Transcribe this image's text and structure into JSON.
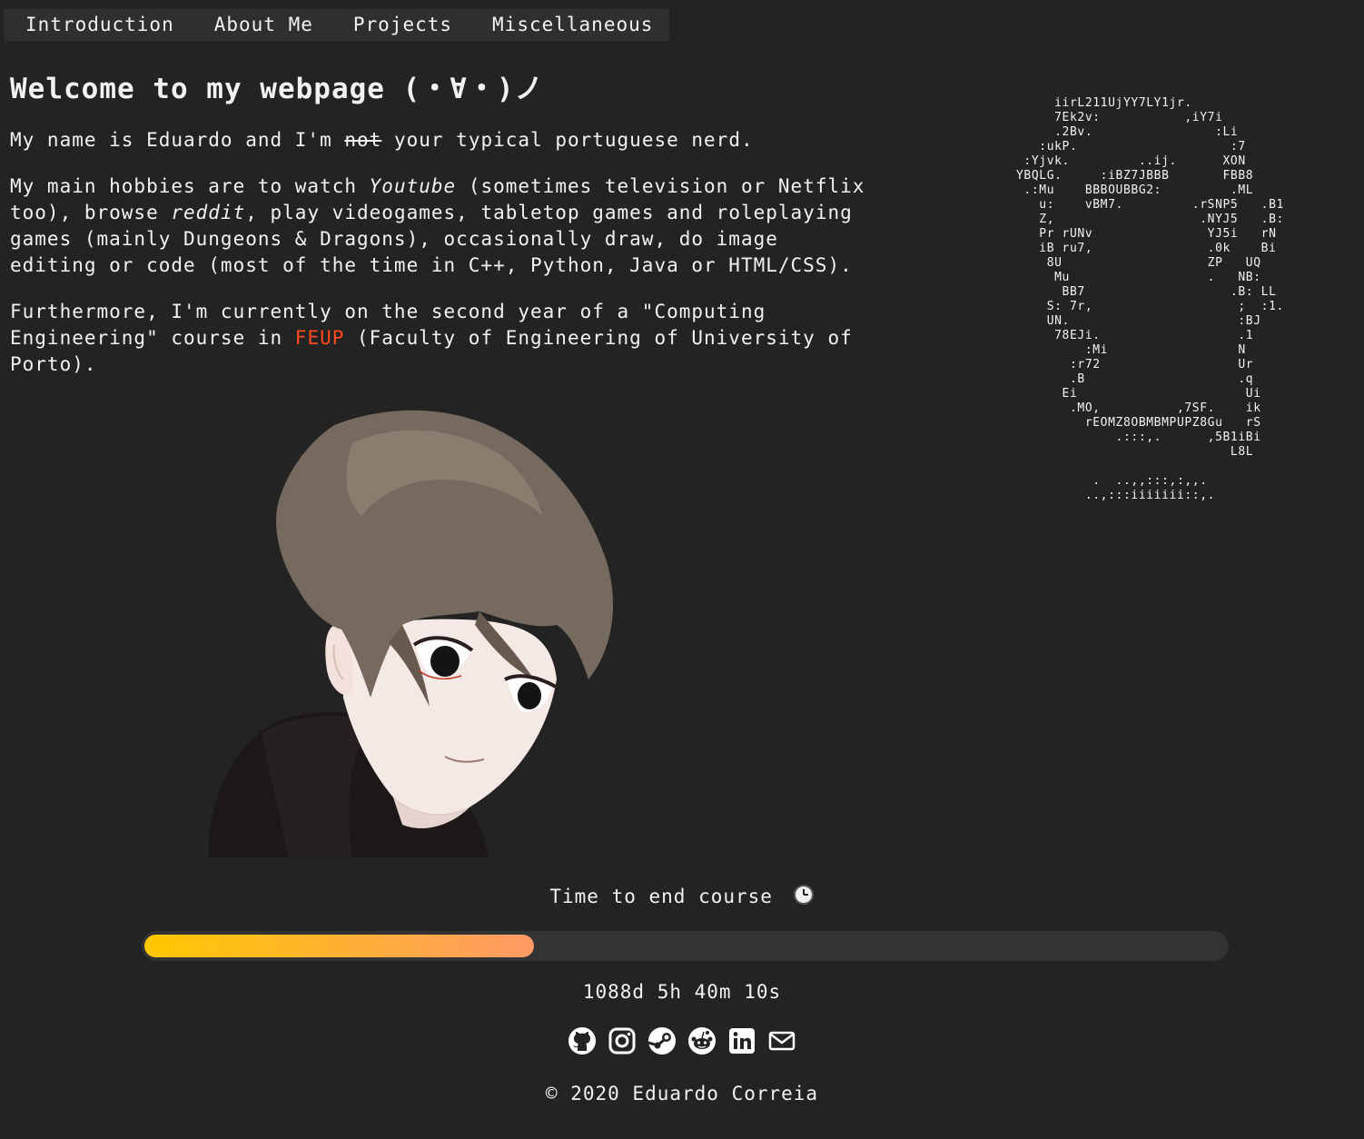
{
  "nav": {
    "items": [
      {
        "label": "Introduction"
      },
      {
        "label": "About Me"
      },
      {
        "label": "Projects"
      },
      {
        "label": "Miscellaneous"
      }
    ]
  },
  "intro": {
    "title": "Welcome to my webpage (・∀・)ノ",
    "p1": {
      "a": "My name is Eduardo and I'm ",
      "strike": "not",
      "b": " your typical portuguese nerd."
    },
    "p2": {
      "a": "My main hobbies are to watch ",
      "youtube": "Youtube",
      "b": " (sometimes television or Netflix too), browse ",
      "reddit": "reddit",
      "c": ", play videogames, tabletop games and roleplaying games (mainly Dungeons & Dragons), occasionally draw, do image editing or code (most of the time in C++, Python, Java or HTML/CSS)."
    },
    "p3": {
      "a": "Furthermore, I'm currently on the second year of a \"Computing Engineering\" course in ",
      "feup": "FEUP",
      "b": " (Faculty of Engineering of University of Porto)."
    }
  },
  "ascii_art": "            iirL211UjYY7LY1jr.\n            7Ek2v:           ,iY7i\n            .2Bv.                :Li\n          :ukP.                    :7\n        :Yjvk.         ..ij.      XON\n       YBQLG.     :iBZ7JBBB       FBB8\n        .:Mu    BBBOUBBG2:         .ML\n          u:    vBM7.         .rSNP5   .B1\n          Z,                   .NYJ5   .B:\n          Pr rUNv               YJ5i   rN\n          iB ru7,               .0k    Bi\n           8U                   ZP   UQ\n            Mu                  .   NB:\n             BB7                   .B: LL\n           S: 7r,                   ;  :1.\n           UN.                      :BJ\n            78EJi.                  .1\n                :Mi                 N\n              :r72                  Ur\n              .B                    .q\n             Ei                      Ui\n              .MO,          ,7SF.    ik\n                rEOMZ8OBMBMPUPZ8Gu   rS\n                    .:::,.      ,5B1iBi\n                                   L8L\n\n                 .  ..,,:::,:,,.\n                ..,:::iiiiiii::,.",
  "colors": {
    "background": "#232323",
    "nav_bg": "#2f2f2f",
    "accent": "#ff4a1c",
    "progress_start": "#ffc800",
    "progress_end": "#ff9a66",
    "track": "#333333"
  },
  "timer": {
    "label": "Time to end course",
    "icon": "clock-icon",
    "progress": 0.36,
    "countdown": "1088d 5h 40m 10s"
  },
  "social": [
    {
      "icon": "github-icon"
    },
    {
      "icon": "instagram-icon"
    },
    {
      "icon": "steam-icon"
    },
    {
      "icon": "reddit-icon"
    },
    {
      "icon": "linkedin-icon"
    },
    {
      "icon": "mail-icon"
    }
  ],
  "footer": {
    "copyright": "© 2020 Eduardo Correia"
  }
}
